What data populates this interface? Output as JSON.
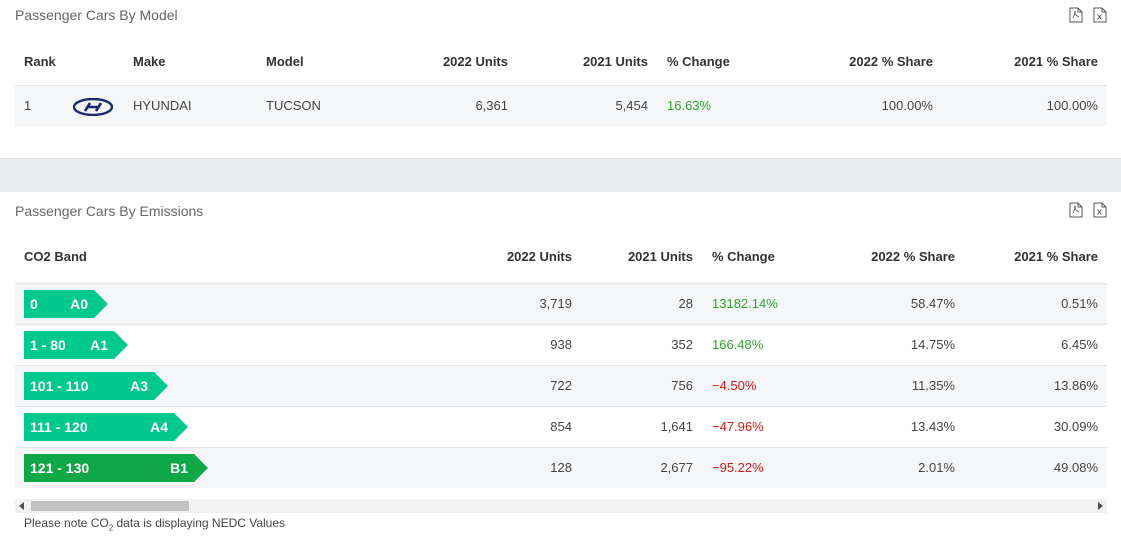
{
  "model_panel": {
    "title": "Passenger Cars By Model",
    "headers": {
      "rank": "Rank",
      "make": "Make",
      "model": "Model",
      "units_2022": "2022 Units",
      "units_2021": "2021 Units",
      "change": "% Change",
      "share_2022": "2022 % Share",
      "share_2021": "2021 % Share"
    },
    "rows": [
      {
        "rank": "1",
        "logo": "hyundai-logo-icon",
        "make": "HYUNDAI",
        "model": "TUCSON",
        "units_2022": "6,361",
        "units_2021": "5,454",
        "change": "16.63%",
        "share_2022": "100.00%",
        "share_2021": "100.00%"
      }
    ]
  },
  "emissions_panel": {
    "title": "Passenger Cars By Emissions",
    "headers": {
      "band": "CO2 Band",
      "units_2022": "2022 Units",
      "units_2021": "2021 Units",
      "change": "% Change",
      "share_2022": "2022 % Share",
      "share_2021": "2021 % Share"
    },
    "rows": [
      {
        "range": "0",
        "code": "A0",
        "color": "#00c98d",
        "units_2022": "3,719",
        "units_2021": "28",
        "change": "13182.14%",
        "trend": "up",
        "share_2022": "58.47%",
        "share_2021": "0.51%"
      },
      {
        "range": "1 - 80",
        "code": "A1",
        "color": "#00c98d",
        "units_2022": "938",
        "units_2021": "352",
        "change": "166.48%",
        "trend": "up",
        "share_2022": "14.75%",
        "share_2021": "6.45%"
      },
      {
        "range": "101 - 110",
        "code": "A3",
        "color": "#00c98d",
        "units_2022": "722",
        "units_2021": "756",
        "change": "−4.50%",
        "trend": "down",
        "share_2022": "11.35%",
        "share_2021": "13.86%"
      },
      {
        "range": "111 - 120",
        "code": "A4",
        "color": "#00c98d",
        "units_2022": "854",
        "units_2021": "1,641",
        "change": "−47.96%",
        "trend": "down",
        "share_2022": "13.43%",
        "share_2021": "30.09%"
      },
      {
        "range": "121 - 130",
        "code": "B1",
        "color": "#10a846",
        "units_2022": "128",
        "units_2021": "2,677",
        "change": "−95.22%",
        "trend": "down",
        "share_2022": "2.01%",
        "share_2021": "49.08%"
      }
    ]
  },
  "note": {
    "before": "Please note CO",
    "sub": "2",
    "after": " data is displaying NEDC Values"
  },
  "icons": {
    "pdf": "pdf-file-icon",
    "excel": "excel-file-icon"
  }
}
